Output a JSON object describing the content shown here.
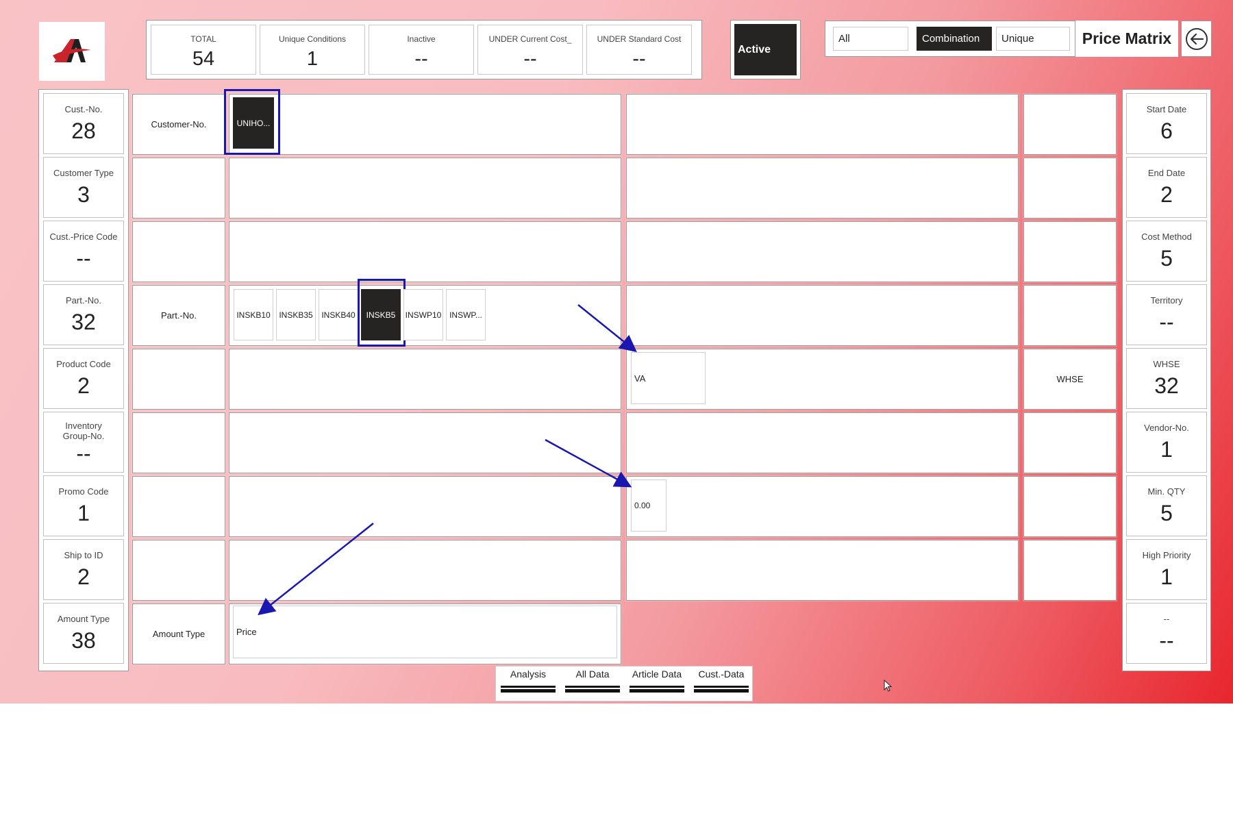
{
  "header": {
    "logo_alt": "company-logo",
    "kpis": [
      {
        "label": "TOTAL",
        "value": "54"
      },
      {
        "label": "Unique Conditions",
        "value": "1"
      },
      {
        "label": "Inactive",
        "value": "--"
      },
      {
        "label": "UNDER Current Cost_",
        "value": "--"
      },
      {
        "label": "UNDER Standard Cost",
        "value": "--"
      }
    ],
    "active_label": "Active",
    "filter_options": [
      {
        "label": "All",
        "selected": false
      },
      {
        "label": "Combination",
        "selected": true
      },
      {
        "label": "Unique",
        "selected": false
      }
    ],
    "title": "Price Matrix"
  },
  "left_stats": [
    {
      "label": "Cust.-No.",
      "value": "28"
    },
    {
      "label": "Customer Type",
      "value": "3"
    },
    {
      "label": "Cust.-Price Code",
      "value": "--"
    },
    {
      "label": "Part.-No.",
      "value": "32"
    },
    {
      "label": "Product Code",
      "value": "2"
    },
    {
      "label": "Inventory Group-No.",
      "value": "--"
    },
    {
      "label": "Promo Code",
      "value": "1"
    },
    {
      "label": "Ship to ID",
      "value": "2"
    },
    {
      "label": "Amount Type",
      "value": "38"
    }
  ],
  "right_stats": [
    {
      "label": "Start Date",
      "value": "6"
    },
    {
      "label": "End Date",
      "value": "2"
    },
    {
      "label": "Cost Method",
      "value": "5"
    },
    {
      "label": "Territory",
      "value": "--"
    },
    {
      "label": "WHSE",
      "value": "32"
    },
    {
      "label": "Vendor-No.",
      "value": "1"
    },
    {
      "label": "Min. QTY",
      "value": "5"
    },
    {
      "label": "High Priority",
      "value": "1"
    },
    {
      "label": "--",
      "value": "--"
    }
  ],
  "grid": {
    "row_labels": [
      "Customer-No.",
      "",
      "",
      "Part.-No.",
      "",
      "",
      "",
      "",
      "Amount Type"
    ],
    "customer_chip": "UNIHO...",
    "part_chips": [
      {
        "label": "INSKB10",
        "selected": false
      },
      {
        "label": "INSKB35",
        "selected": false
      },
      {
        "label": "INSKB40",
        "selected": false
      },
      {
        "label": "INSKB5",
        "selected": true
      },
      {
        "label": "INSWP10",
        "selected": false
      },
      {
        "label": "INSWP...",
        "selected": false
      }
    ],
    "amount_type_value": "Price",
    "territory_value": "VA",
    "min_qty_value": "0.00",
    "whse_label": "WHSE"
  },
  "tabs": [
    {
      "label": "Analysis"
    },
    {
      "label": "All Data"
    },
    {
      "label": "Article Data"
    },
    {
      "label": "Cust.-Data"
    }
  ],
  "colors": {
    "accent_dark": "#252423",
    "highlight": "#1a17b0",
    "background_gradient_start": "#f9c3c6",
    "background_gradient_end": "#e8262e"
  },
  "icons": [
    "back-arrow-icon",
    "company-logo-icon",
    "mouse-cursor-icon"
  ]
}
